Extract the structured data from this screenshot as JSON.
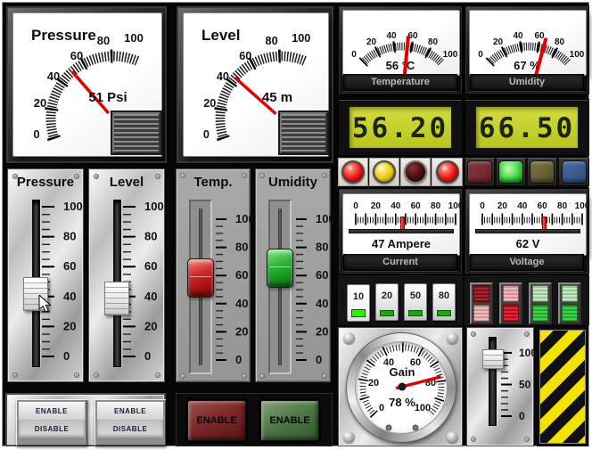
{
  "panels": {
    "pressure_gauge": {
      "title": "Pressure",
      "value": 51,
      "value_text": "51 Psi",
      "ticks": [
        "0",
        "20",
        "40",
        "60",
        "80",
        "100"
      ]
    },
    "level_gauge": {
      "title": "Level",
      "value": 45,
      "value_text": "45 m",
      "ticks": [
        "0",
        "20",
        "40",
        "60",
        "80",
        "100"
      ]
    },
    "temperature_meter": {
      "label": "Temperature",
      "value": 56,
      "value_text": "56 °C",
      "ticks": [
        "0",
        "20",
        "40",
        "60",
        "80",
        "100"
      ]
    },
    "umidity_meter": {
      "label": "Umidity",
      "value": 67,
      "value_text": "67 %",
      "ticks": [
        "0",
        "20",
        "40",
        "60",
        "80",
        "100"
      ]
    },
    "temperature_lcd": {
      "value": "56.20"
    },
    "umidity_lcd": {
      "value": "66.50"
    },
    "current_meter": {
      "label": "Current",
      "value": 47,
      "value_text": "47 Ampere",
      "ticks": [
        "0",
        "20",
        "40",
        "60",
        "80",
        "100"
      ]
    },
    "voltage_meter": {
      "label": "Voltage",
      "value": 62,
      "value_text": "62 V",
      "ticks": [
        "0",
        "20",
        "40",
        "60",
        "80",
        "100"
      ]
    },
    "gain_gauge": {
      "title": "Gain",
      "value": 78,
      "value_text": "78 %",
      "ticks": [
        "0",
        "20",
        "40",
        "60",
        "80",
        "100"
      ]
    },
    "gain_slider": {
      "value": 90,
      "ticks": [
        "100",
        "50",
        "0"
      ]
    },
    "pressure_slider": {
      "title": "Pressure",
      "value": 43,
      "ticks": [
        "100",
        "80",
        "60",
        "40",
        "20",
        "0"
      ]
    },
    "level_slider": {
      "title": "Level",
      "value": 40,
      "ticks": [
        "100",
        "80",
        "60",
        "40",
        "20",
        "0"
      ]
    },
    "temp_slider": {
      "title": "Temp.",
      "value": 58,
      "ticks": [
        "100",
        "80",
        "60",
        "40",
        "20",
        "0"
      ]
    },
    "umidity_slider": {
      "title": "Umidity",
      "value": 65,
      "ticks": [
        "100",
        "80",
        "60",
        "40",
        "20",
        "0"
      ]
    }
  },
  "round_leds": [
    {
      "color": "red",
      "state": "on"
    },
    {
      "color": "yellow",
      "state": "on"
    },
    {
      "color": "red",
      "state": "off"
    },
    {
      "color": "red",
      "state": "on"
    }
  ],
  "square_lamps": [
    {
      "color": "red",
      "state": "off"
    },
    {
      "color": "green",
      "state": "on"
    },
    {
      "color": "yellow",
      "state": "off"
    },
    {
      "color": "blue",
      "state": "off"
    }
  ],
  "selector_buttons": [
    {
      "label": "10",
      "pressed": true
    },
    {
      "label": "20",
      "pressed": false
    },
    {
      "label": "50",
      "pressed": false
    },
    {
      "label": "80",
      "pressed": false
    }
  ],
  "rocker_switches": [
    {
      "color": "red",
      "position": "down"
    },
    {
      "color": "red",
      "position": "up"
    },
    {
      "color": "green",
      "position": "up"
    },
    {
      "color": "green",
      "position": "up"
    }
  ],
  "enable_rockers": [
    {
      "top": "ENABLE",
      "bottom": "DISABLE"
    },
    {
      "top": "ENABLE",
      "bottom": "DISABLE"
    }
  ],
  "enable_buttons": [
    {
      "label": "ENABLE",
      "color": "red"
    },
    {
      "label": "ENABLE",
      "color": "green"
    }
  ]
}
